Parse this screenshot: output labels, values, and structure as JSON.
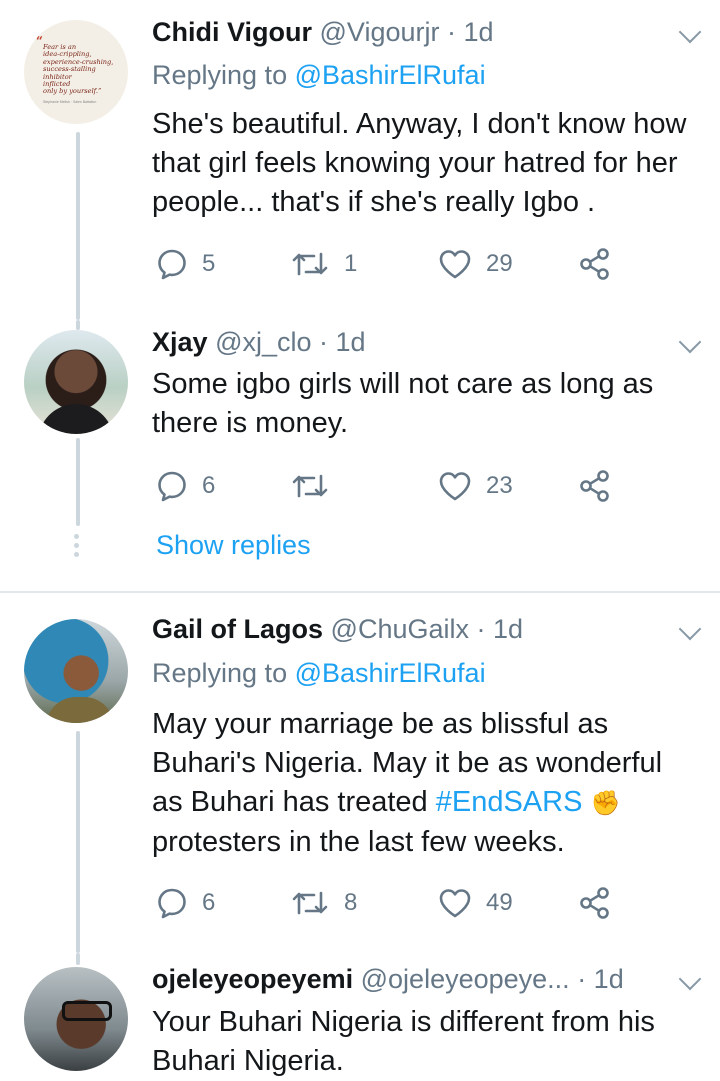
{
  "tweets": [
    {
      "name": "Chidi Vigour",
      "handle": "@Vigourjr",
      "time": "· 1d",
      "reply_prefix": "Replying to ",
      "reply_to": "@BashirElRufai",
      "text": "She's beautiful. Anyway, I don't know how that girl feels knowing your hatred for her people... that's if she's really Igbo .",
      "avatar_quote": [
        "Fear is an",
        "idea-crippling,",
        "experience-crushing,",
        "success-stalling",
        "inhibitor",
        "inflicted",
        "only by yourself.”"
      ],
      "avatar_credit": "Stephanie Melish · Sales Battalion",
      "replies": "5",
      "retweets": "1",
      "likes": "29"
    },
    {
      "name": "Xjay",
      "handle": "@xj_clo",
      "time": "· 1d",
      "text": "Some igbo girls will not care as long as there is money.",
      "replies": "6",
      "retweets": "",
      "likes": "23",
      "show_replies": "Show replies"
    },
    {
      "name": "Gail of Lagos",
      "handle": "@ChuGailx",
      "time": "· 1d",
      "reply_prefix": "Replying to ",
      "reply_to": "@BashirElRufai",
      "text_before": "May your marriage be as blissful as Buhari's Nigeria. May it be as wonderful as Buhari has treated ",
      "hashtag": "#EndSARS",
      "emoji": "✊",
      "text_after": " protesters in the last few weeks.",
      "replies": "6",
      "retweets": "8",
      "likes": "49"
    },
    {
      "name": "ojeleyeopeyemi",
      "handle": "@ojeleyeopeye...",
      "time": "· 1d",
      "text": "Your Buhari Nigeria is different from his Buhari Nigeria."
    }
  ],
  "colors": {
    "link": "#1da1f2",
    "secondary": "#657786",
    "divider": "#e1e8ed",
    "thread_line": "#ccd6dd"
  },
  "icons": [
    "reply-icon",
    "retweet-icon",
    "like-icon",
    "share-icon",
    "chevron-down-icon"
  ]
}
